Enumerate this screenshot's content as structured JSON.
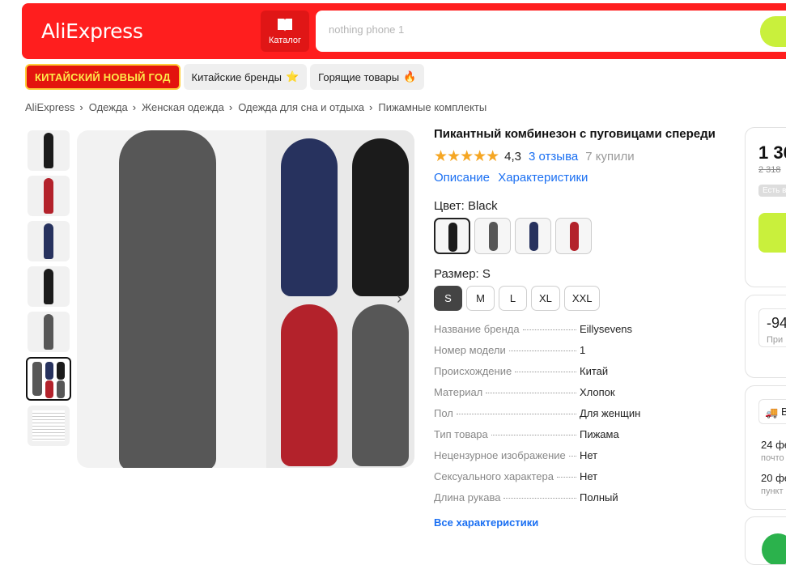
{
  "header": {
    "logo": "AliExpress",
    "catalog_label": "Каталог",
    "search_placeholder": "nothing phone 1",
    "colors": {
      "bar": "#ff1e1e",
      "search_button": "#c9f03c"
    }
  },
  "promo_tags": [
    {
      "label": "КИТАЙСКИЙ НОВЫЙ ГОД"
    },
    {
      "label": "Китайские бренды",
      "emoji": "⭐"
    },
    {
      "label": "Горящие товары",
      "emoji": "🔥"
    }
  ],
  "breadcrumb": [
    "AliExpress",
    "Одежда",
    "Женская одежда",
    "Одежда для сна и отдыха",
    "Пижамные комплекты"
  ],
  "product": {
    "title": "Пикантный комбинезон с пуговицами спереди",
    "rating_stars": "★★★★★",
    "rating_value": 4.3,
    "rating": "4,3",
    "reviews": "3 отзыва",
    "sold": "7 купили",
    "links": [
      "Описание",
      "Характеристики"
    ],
    "color_label": "Цвет: Black",
    "color_options": [
      {
        "name": "Black",
        "hex": "#1b1b1b",
        "selected": true
      },
      {
        "name": "Gray",
        "hex": "#575757",
        "selected": false
      },
      {
        "name": "Navy",
        "hex": "#27325e",
        "selected": false
      },
      {
        "name": "Red",
        "hex": "#b3222b",
        "selected": false
      }
    ],
    "size_label": "Размер: S",
    "sizes": [
      "S",
      "M",
      "L",
      "XL",
      "XXL"
    ],
    "selected_size": "S"
  },
  "specs": [
    {
      "key": "Название бренда",
      "value": "Eillysevens"
    },
    {
      "key": "Номер модели",
      "value": "1"
    },
    {
      "key": "Происхождение",
      "value": "Китай"
    },
    {
      "key": "Материал",
      "value": "Хлопок"
    },
    {
      "key": "Пол",
      "value": "Для женщин"
    },
    {
      "key": "Тип товара",
      "value": "Пижама"
    },
    {
      "key": "Нецензурное изображение",
      "value": "Нет"
    },
    {
      "key": "Сексуального характера",
      "value": "Нет"
    },
    {
      "key": "Длина рукава",
      "value": "Полный"
    }
  ],
  "all_specs_link": "Все характеристики",
  "sidebar": {
    "price": "1 36",
    "old_price": "2 318",
    "badge": "Есть в",
    "coupon": "-94",
    "coupon_sub": "При",
    "delivery_label": "В",
    "delivery_1": "24 фе",
    "delivery_1_sub": "почто",
    "delivery_2": "20 фе",
    "delivery_2_sub": "пункт"
  }
}
